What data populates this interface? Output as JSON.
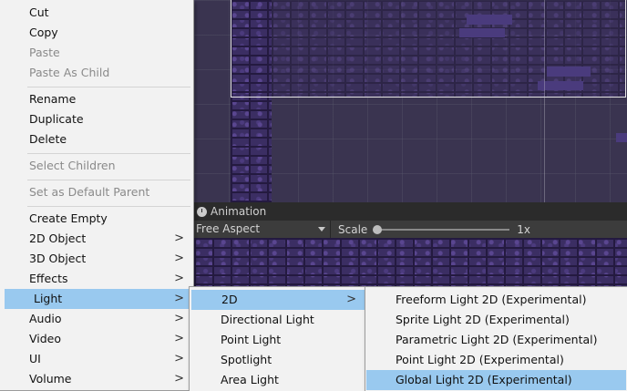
{
  "context_menu": {
    "items": [
      {
        "label": "Cut",
        "enabled": true
      },
      {
        "label": "Copy",
        "enabled": true
      },
      {
        "label": "Paste",
        "enabled": false
      },
      {
        "label": "Paste As Child",
        "enabled": false
      },
      {
        "label": "Rename",
        "enabled": true
      },
      {
        "label": "Duplicate",
        "enabled": true
      },
      {
        "label": "Delete",
        "enabled": true
      },
      {
        "label": "Select Children",
        "enabled": false
      },
      {
        "label": "Set as Default Parent",
        "enabled": false
      },
      {
        "label": "Create Empty",
        "enabled": true
      },
      {
        "label": "2D Object",
        "enabled": true,
        "submenu": true
      },
      {
        "label": "3D Object",
        "enabled": true,
        "submenu": true
      },
      {
        "label": "Effects",
        "enabled": true,
        "submenu": true
      },
      {
        "label": "Light",
        "enabled": true,
        "submenu": true,
        "highlighted": true
      },
      {
        "label": "Audio",
        "enabled": true,
        "submenu": true
      },
      {
        "label": "Video",
        "enabled": true,
        "submenu": true
      },
      {
        "label": "UI",
        "enabled": true,
        "submenu": true
      },
      {
        "label": "Volume",
        "enabled": true,
        "submenu": true
      }
    ],
    "submenu_arrow": ">"
  },
  "light_submenu": {
    "items": [
      {
        "label": "2D",
        "submenu": true,
        "highlighted": true
      },
      {
        "label": "Directional Light"
      },
      {
        "label": "Point Light"
      },
      {
        "label": "Spotlight"
      },
      {
        "label": "Area Light"
      }
    ]
  },
  "light2d_submenu": {
    "items": [
      {
        "label": "Freeform Light 2D (Experimental)"
      },
      {
        "label": "Sprite Light 2D (Experimental)"
      },
      {
        "label": "Parametric Light 2D (Experimental)"
      },
      {
        "label": "Point Light 2D (Experimental)"
      },
      {
        "label": "Global Light 2D (Experimental)",
        "highlighted": true
      }
    ]
  },
  "animation_panel": {
    "title": "Animation",
    "icon": "animation-clock-icon"
  },
  "game_toolbar": {
    "aspect": "Free Aspect",
    "scale_label": "Scale",
    "scale_value": "1x",
    "scale_slider_position": 0.0
  },
  "colors": {
    "highlight": "#99c9ef",
    "menu_bg": "#f2f2f2",
    "disabled_text": "#8a8a8a",
    "editor_dark": "#2b2b2b"
  }
}
